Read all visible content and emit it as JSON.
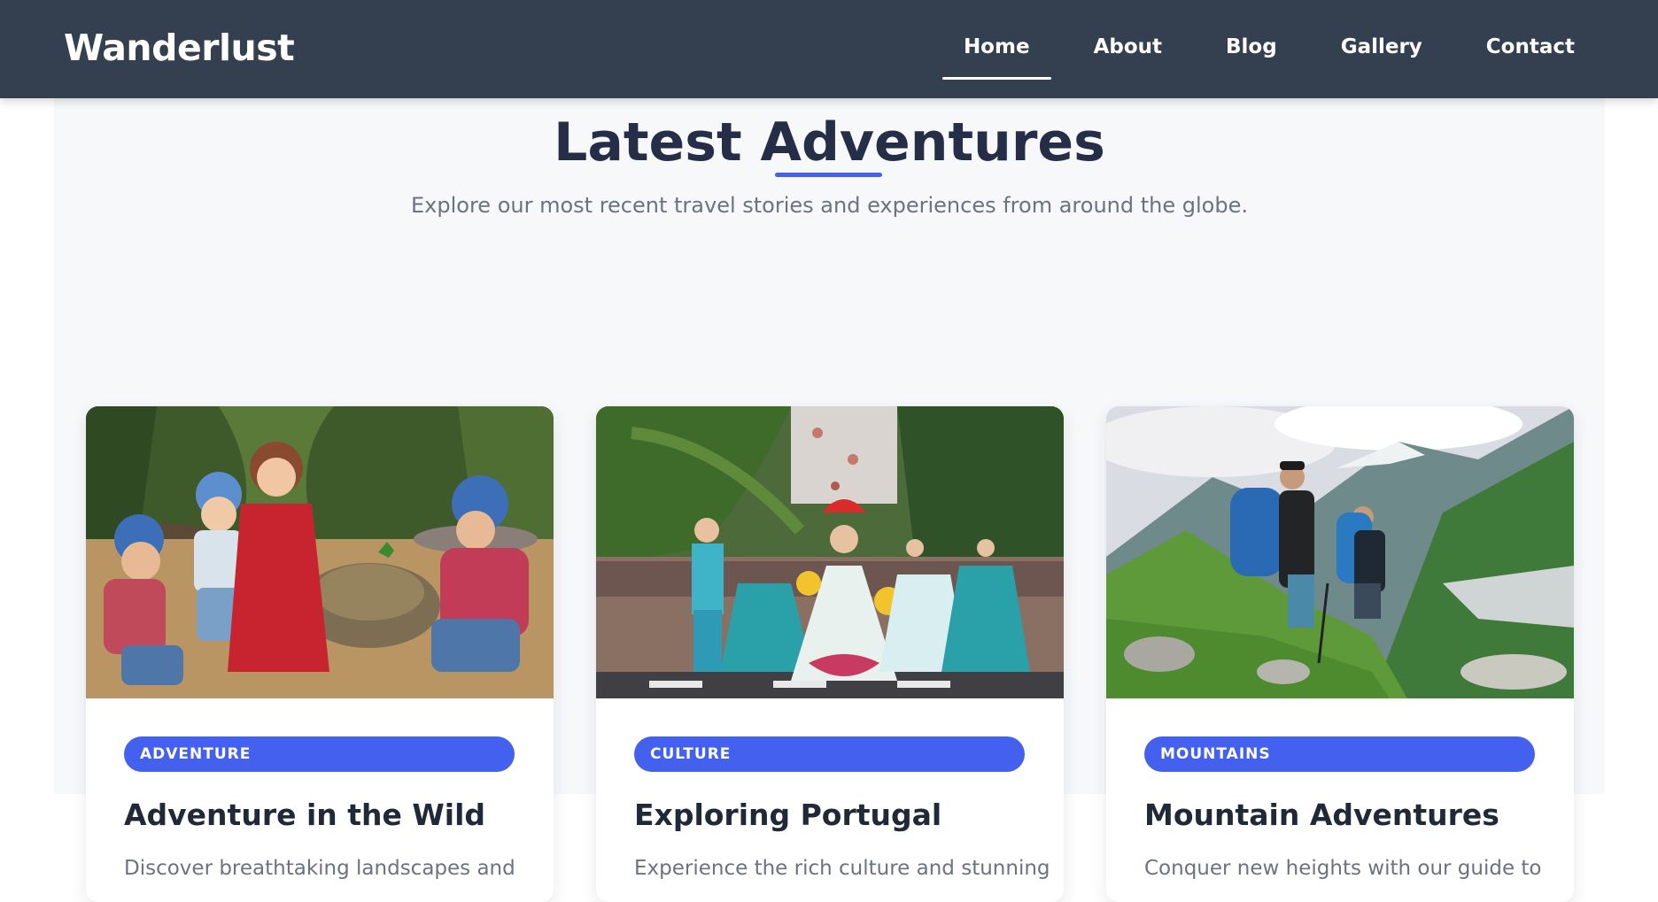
{
  "brand": {
    "logo_text": "Wanderlust"
  },
  "nav": {
    "items": [
      {
        "label": "Home",
        "active": true
      },
      {
        "label": "About",
        "active": false
      },
      {
        "label": "Blog",
        "active": false
      },
      {
        "label": "Gallery",
        "active": false
      },
      {
        "label": "Contact",
        "active": false
      }
    ]
  },
  "section": {
    "title": "Latest Adventures",
    "subtitle": "Explore our most recent travel stories and experiences from around the globe."
  },
  "cards": [
    {
      "badge": "ADVENTURE",
      "title": "Adventure in the Wild",
      "description": "Discover breathtaking landscapes and"
    },
    {
      "badge": "CULTURE",
      "title": "Exploring Portugal",
      "description": "Experience the rich culture and stunning"
    },
    {
      "badge": "MOUNTAINS",
      "title": "Mountain Adventures",
      "description": "Conquer new heights with our guide to"
    }
  ],
  "colors": {
    "navbar_bg": "#34404f",
    "accent": "#4361ee",
    "heading": "#262d47",
    "muted_text": "#6b7280",
    "section_bg": "#f7f8fa"
  }
}
